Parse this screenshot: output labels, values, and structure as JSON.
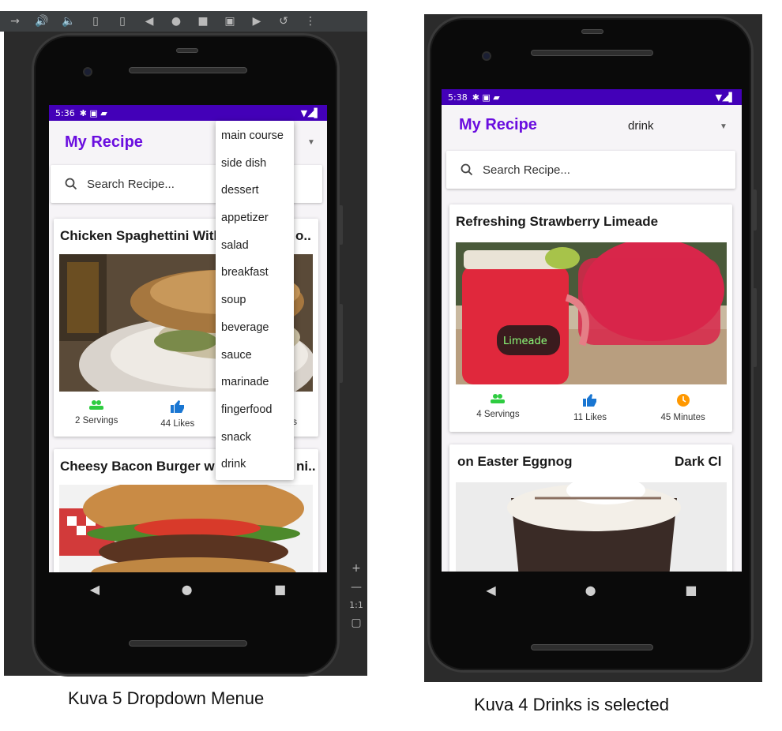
{
  "left": {
    "toolbar_icons": [
      "→",
      "🔊",
      "🔈",
      "▯",
      "▯",
      "◀",
      "●",
      "■",
      "▣",
      "▶",
      "↺",
      "⋮"
    ],
    "side_controls": [
      "+",
      "—",
      "1:1",
      "▢"
    ],
    "status_time": "5:36",
    "status_icons": "✱ ▣ ▰",
    "status_right": "▼◢▌",
    "app_title": "My Recipe",
    "search_placeholder": "Search Recipe...",
    "card1_title": "Chicken Spaghettini With Parmesan Bread Crumbs Parmesan Pangrattato Deli..",
    "card1_title_tail": "o..",
    "card1_servings": "2 Servings",
    "card1_likes": "44 Likes",
    "card1_minutes_tail": "s",
    "card2_title": "Cheesy Bacon Burger w",
    "card2_title_tail": "ni..",
    "dropdown": [
      "main course",
      "side dish",
      "dessert",
      "appetizer",
      "salad",
      "breakfast",
      "soup",
      "beverage",
      "sauce",
      "marinade",
      "fingerfood",
      "snack",
      "drink"
    ],
    "caption": "Kuva 5 Dropdown Menue"
  },
  "right": {
    "status_time": "5:38",
    "status_icons": "✱ ▣ ▰",
    "status_right": "▼◢▌",
    "app_title": "My Recipe",
    "selected_category": "drink",
    "search_placeholder": "Search Recipe...",
    "card1_title": "Refreshing Strawberry Limeade",
    "card1_servings": "4 Servings",
    "card1_likes": "11 Likes",
    "card1_minutes": "45 Minutes",
    "jar_label": "Limeade",
    "card2_title_left": "on Easter Eggnog",
    "card2_title_right": "Dark Cl",
    "caption": "Kuva 4 Drinks is selected"
  },
  "nav_icons": [
    "◀",
    "●",
    "■"
  ],
  "colors": {
    "status_bar": "#4300b8",
    "title": "#6a0ddf",
    "servings_icon": "#2ecc40",
    "likes_icon": "#1976d2",
    "time_icon": "#ff9800"
  }
}
